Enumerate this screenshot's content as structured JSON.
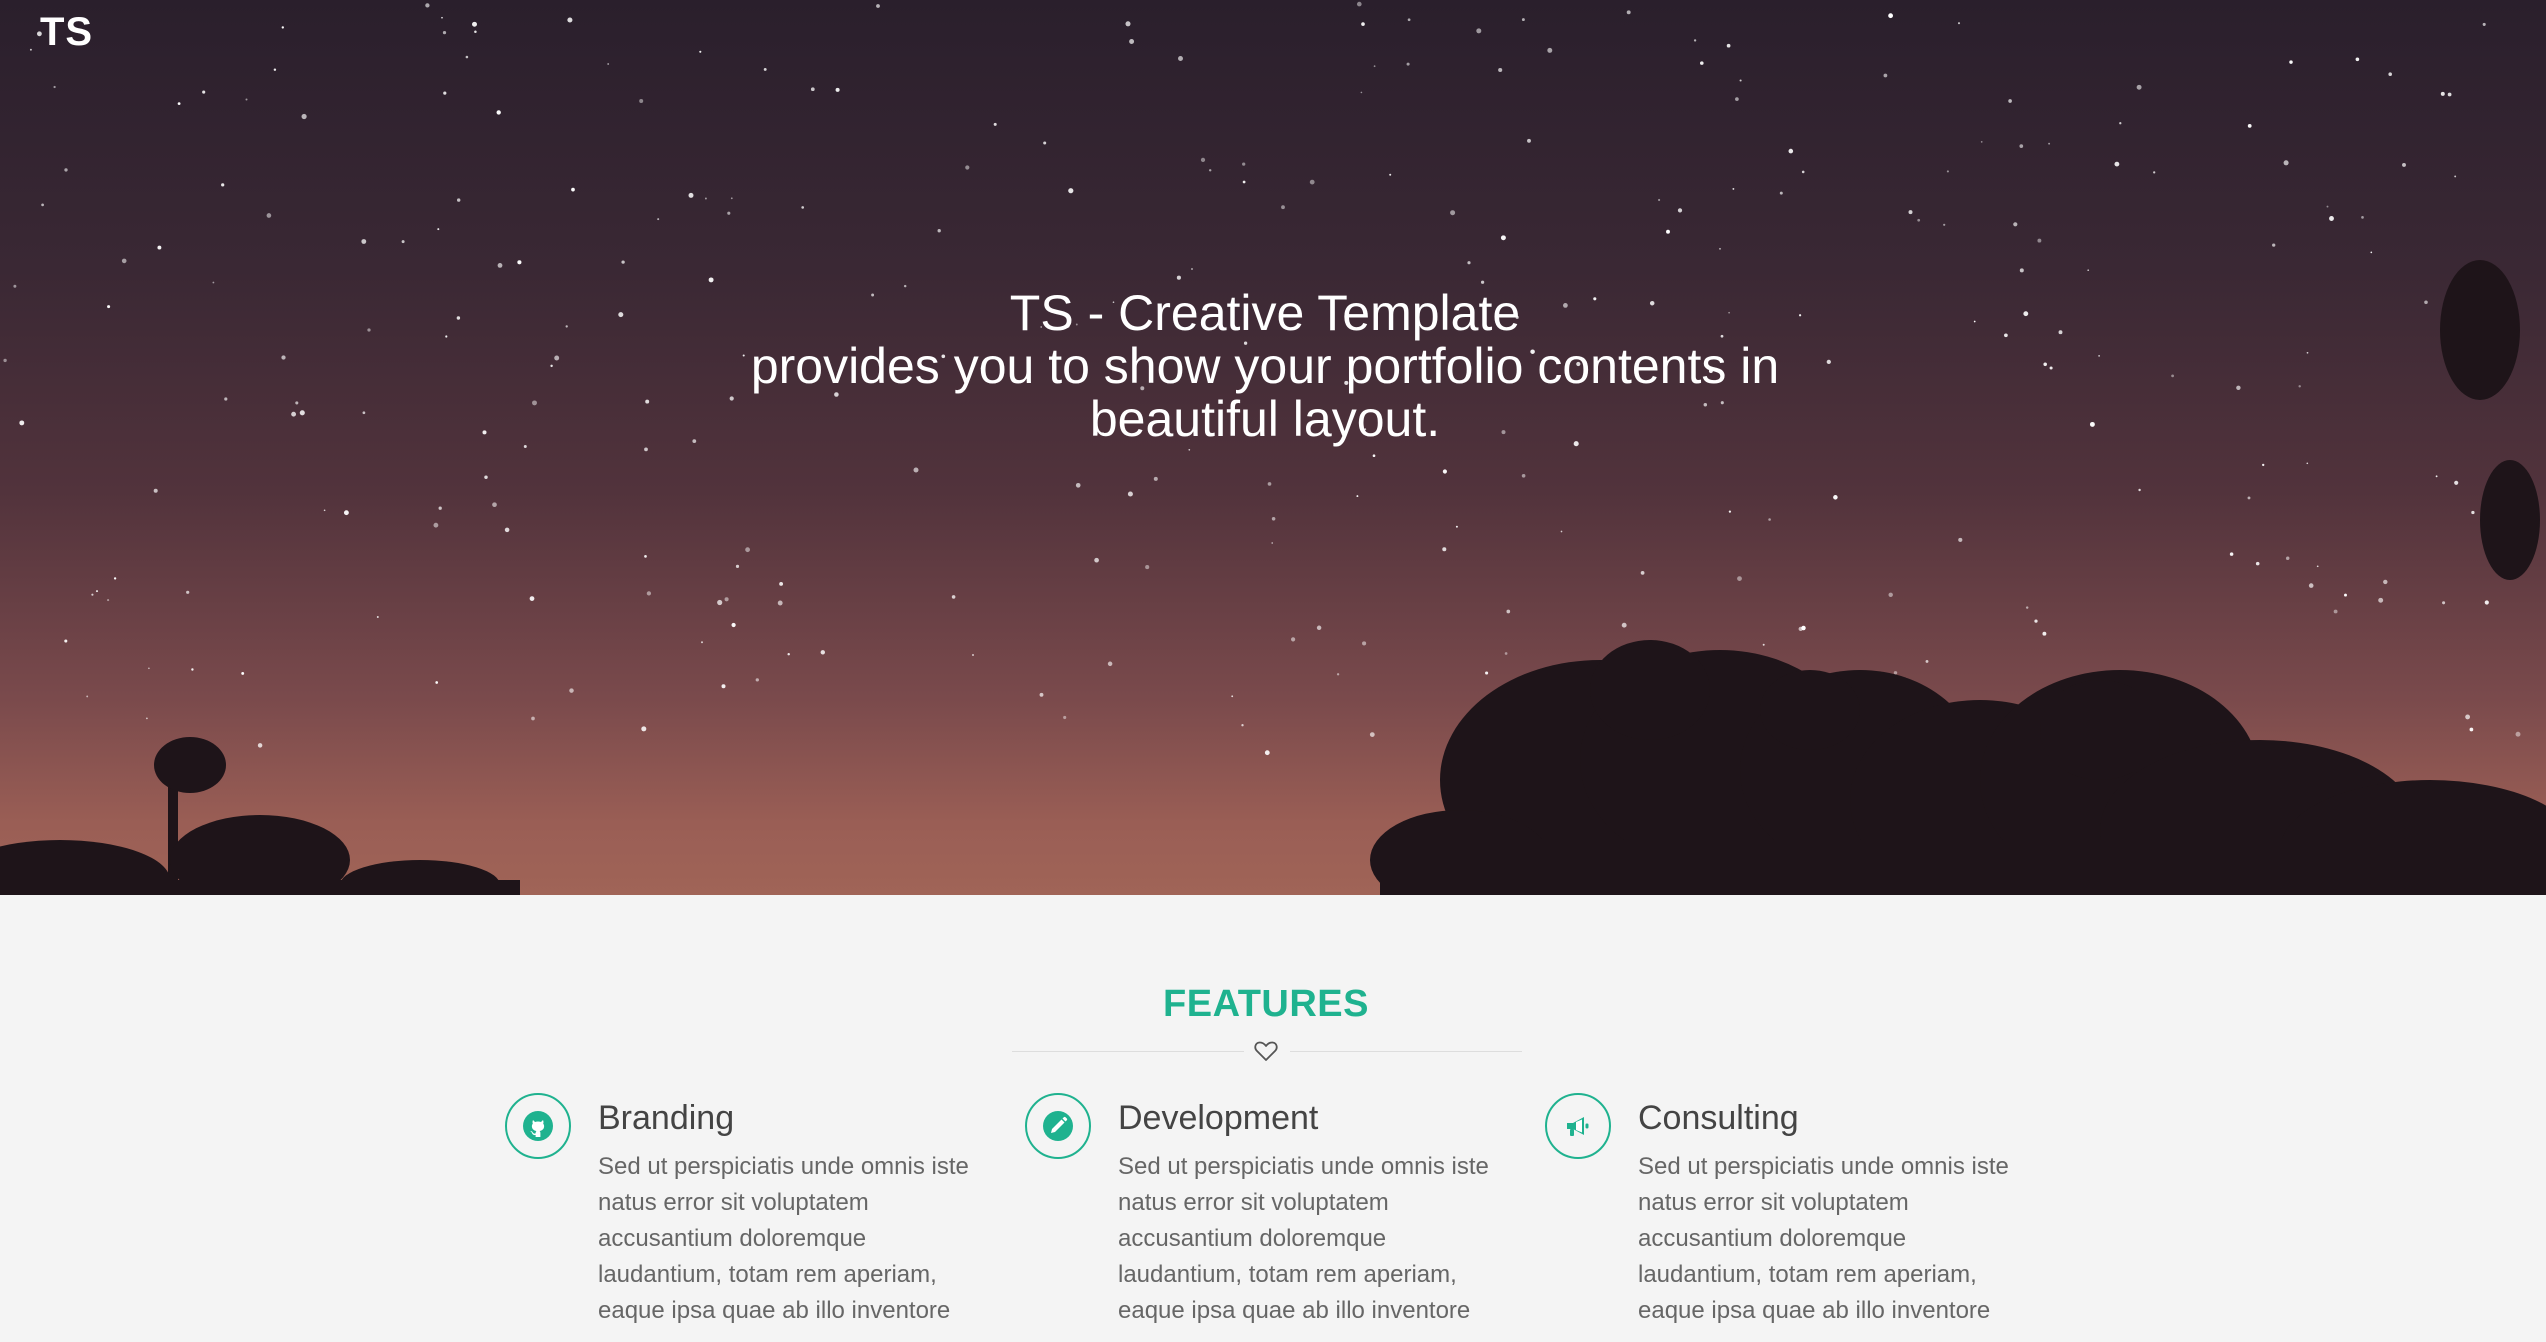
{
  "logo": "TS",
  "hero": {
    "title_line1": "TS - Creative Template",
    "title_line2": "provides you to show your portfolio contents in",
    "title_line3": "beautiful layout."
  },
  "features": {
    "heading": "FEATURES",
    "items": [
      {
        "icon": "github-icon",
        "title": "Branding",
        "description": "Sed ut perspiciatis unde omnis iste natus error sit voluptatem accusantium doloremque laudantium, totam rem aperiam, eaque ipsa quae ab illo inventore"
      },
      {
        "icon": "pencil-icon",
        "title": "Development",
        "description": "Sed ut perspiciatis unde omnis iste natus error sit voluptatem accusantium doloremque laudantium, totam rem aperiam, eaque ipsa quae ab illo inventore"
      },
      {
        "icon": "megaphone-icon",
        "title": "Consulting",
        "description": "Sed ut perspiciatis unde omnis iste natus error sit voluptatem accusantium doloremque laudantium, totam rem aperiam, eaque ipsa quae ab illo inventore"
      }
    ]
  },
  "colors": {
    "accent": "#1fb28f",
    "hero_top": "#2a1f2c",
    "hero_bottom": "#a06457",
    "section_bg": "#f4f4f4"
  }
}
